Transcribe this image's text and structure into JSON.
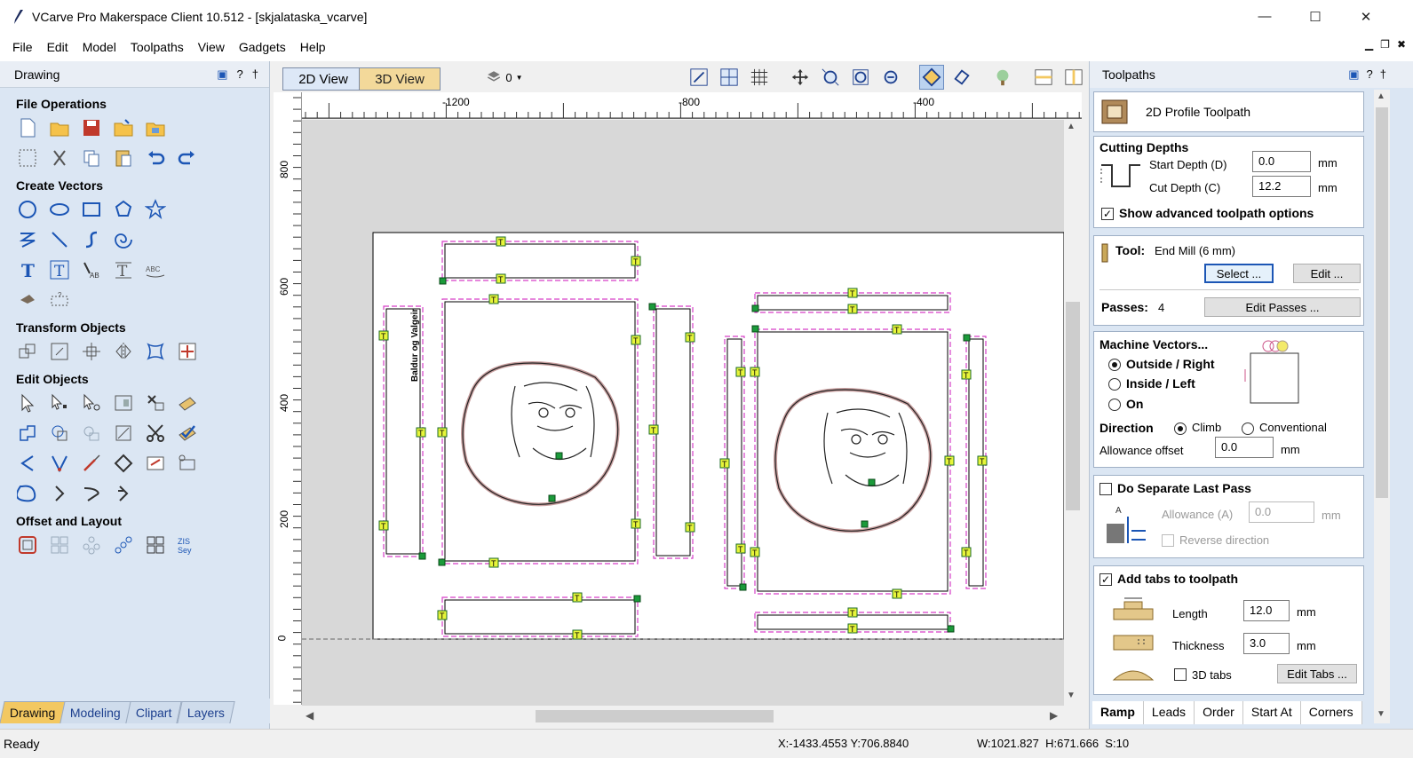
{
  "window": {
    "title": "VCarve Pro Makerspace Client 10.512 - [skjalataska_vcarve]"
  },
  "menu": [
    "File",
    "Edit",
    "Model",
    "Toolpaths",
    "View",
    "Gadgets",
    "Help"
  ],
  "left_panel": {
    "title": "Drawing",
    "sections": {
      "file_ops": "File Operations",
      "create_vectors": "Create Vectors",
      "transform": "Transform Objects",
      "edit": "Edit Objects",
      "offset": "Offset and Layout"
    },
    "tabs": [
      "Drawing",
      "Modeling",
      "Clipart",
      "Layers"
    ]
  },
  "view_tabs": {
    "tab_2d": "2D View",
    "tab_3d": "3D View",
    "layer_count": "0"
  },
  "rulers": {
    "h_ticks": [
      "-1200",
      "-800",
      "-400"
    ],
    "v_ticks": [
      "800",
      "600",
      "400",
      "200",
      "0"
    ]
  },
  "canvas": {
    "vertical_text": "Baldur og Valgeir",
    "tab_marker": "T"
  },
  "right_panel": {
    "title": "Toolpaths",
    "header": "2D Profile Toolpath",
    "cutting_depths": {
      "title": "Cutting Depths",
      "start_label": "Start Depth (D)",
      "start_value": "0.0",
      "cut_label": "Cut Depth (C)",
      "cut_value": "12.2",
      "unit": "mm",
      "advanced": "Show advanced toolpath options"
    },
    "tool": {
      "label": "Tool:",
      "name": "End Mill (6 mm)",
      "select_btn": "Select ...",
      "edit_btn": "Edit ...",
      "passes_label": "Passes:",
      "passes_value": "4",
      "edit_passes_btn": "Edit Passes ..."
    },
    "machine": {
      "title": "Machine Vectors...",
      "outside": "Outside / Right",
      "inside": "Inside / Left",
      "on": "On",
      "direction_label": "Direction",
      "climb": "Climb",
      "conventional": "Conventional",
      "allowance_label": "Allowance offset",
      "allowance_value": "0.0",
      "unit": "mm"
    },
    "last_pass": {
      "title": "Do Separate Last Pass",
      "allowance_label": "Allowance (A)",
      "allowance_value": "0.0",
      "unit": "mm",
      "reverse": "Reverse direction"
    },
    "tabs_section": {
      "title": "Add tabs to toolpath",
      "length_label": "Length",
      "length_value": "12.0",
      "thickness_label": "Thickness",
      "thickness_value": "3.0",
      "unit": "mm",
      "tabs3d": "3D tabs",
      "edit_tabs_btn": "Edit Tabs ..."
    },
    "bottom_tabs": [
      "Ramp",
      "Leads",
      "Order",
      "Start At",
      "Corners"
    ]
  },
  "status": {
    "ready": "Ready",
    "coords": "X:-1433.4553 Y:706.8840",
    "dims": "W:1021.827  H:671.666  S:10"
  },
  "colors": {
    "accent": "#f3c861",
    "toolpath": "#d63fc8",
    "tab_marker": "#e7f53a"
  }
}
